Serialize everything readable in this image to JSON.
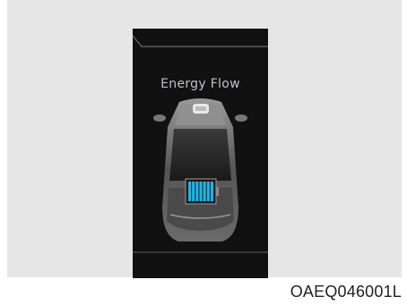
{
  "screen": {
    "title": "Energy Flow"
  },
  "battery": {
    "cells": 7,
    "charge_fraction": 1.0,
    "cell_color": "#1fb6e8"
  },
  "figure_code": "OAEQ046001L",
  "colors": {
    "display_bg": "#111111",
    "frame_bg": "#e6e6e6",
    "title_text": "#b9c3cf"
  }
}
